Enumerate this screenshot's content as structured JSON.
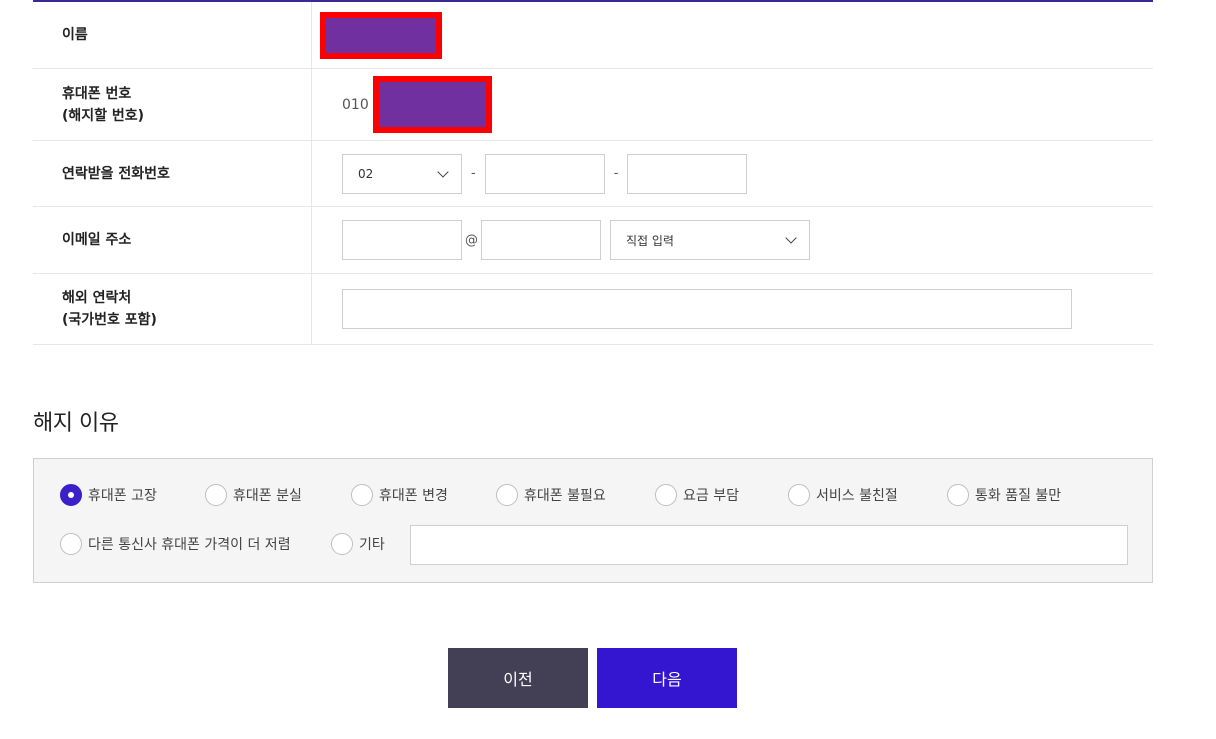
{
  "form": {
    "name": {
      "label": "이름"
    },
    "phone": {
      "label_line1": "휴대폰 번호",
      "label_line2": "(해지할 번호)",
      "prefix": "010"
    },
    "contact": {
      "label": "연락받을 전화번호",
      "area_code": "02",
      "separator": "-"
    },
    "email": {
      "label": "이메일 주소",
      "at": "@",
      "domain_select": "직접 입력"
    },
    "overseas": {
      "label_line1": "해외 연락처",
      "label_line2": "(국가번호 포함)"
    }
  },
  "reason": {
    "title": "해지 이유",
    "options": [
      {
        "label": "휴대폰 고장",
        "checked": true
      },
      {
        "label": "휴대폰 분실",
        "checked": false
      },
      {
        "label": "휴대폰 변경",
        "checked": false
      },
      {
        "label": "휴대폰 불필요",
        "checked": false
      },
      {
        "label": "요금 부담",
        "checked": false
      },
      {
        "label": "서비스 불친절",
        "checked": false
      },
      {
        "label": "통화 품질 불만",
        "checked": false
      },
      {
        "label": "다른 통신사 휴대폰 가격이 더 저렴",
        "checked": false
      },
      {
        "label": "기타",
        "checked": false
      }
    ]
  },
  "buttons": {
    "prev": "이전",
    "next": "다음"
  },
  "colors": {
    "accent": "#3416d1",
    "prev_button": "#434056",
    "mask_fill": "#7030a0",
    "mask_border": "#ff0000"
  }
}
